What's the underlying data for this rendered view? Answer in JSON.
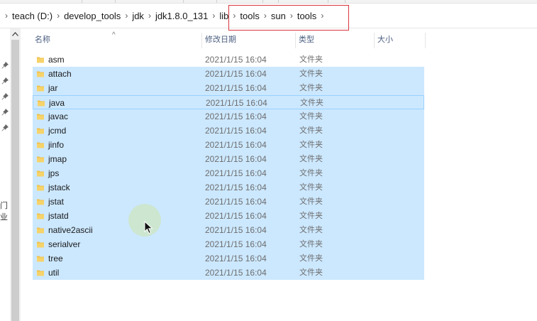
{
  "breadcrumb": {
    "items": [
      "teach (D:)",
      "develop_tools",
      "jdk",
      "jdk1.8.0_131",
      "lib",
      "tools",
      "sun",
      "tools"
    ]
  },
  "nav": {
    "stub_text": "门业"
  },
  "columns": {
    "name": "名称",
    "date": "修改日期",
    "type": "类型",
    "size": "大小"
  },
  "files": [
    {
      "name": "asm",
      "date": "2021/1/15 16:04",
      "type": "文件夹",
      "size": "",
      "selected": false
    },
    {
      "name": "attach",
      "date": "2021/1/15 16:04",
      "type": "文件夹",
      "size": "",
      "selected": true
    },
    {
      "name": "jar",
      "date": "2021/1/15 16:04",
      "type": "文件夹",
      "size": "",
      "selected": true
    },
    {
      "name": "java",
      "date": "2021/1/15 16:04",
      "type": "文件夹",
      "size": "",
      "selected": true,
      "focused": true
    },
    {
      "name": "javac",
      "date": "2021/1/15 16:04",
      "type": "文件夹",
      "size": "",
      "selected": true
    },
    {
      "name": "jcmd",
      "date": "2021/1/15 16:04",
      "type": "文件夹",
      "size": "",
      "selected": true
    },
    {
      "name": "jinfo",
      "date": "2021/1/15 16:04",
      "type": "文件夹",
      "size": "",
      "selected": true
    },
    {
      "name": "jmap",
      "date": "2021/1/15 16:04",
      "type": "文件夹",
      "size": "",
      "selected": true
    },
    {
      "name": "jps",
      "date": "2021/1/15 16:04",
      "type": "文件夹",
      "size": "",
      "selected": true
    },
    {
      "name": "jstack",
      "date": "2021/1/15 16:04",
      "type": "文件夹",
      "size": "",
      "selected": true
    },
    {
      "name": "jstat",
      "date": "2021/1/15 16:04",
      "type": "文件夹",
      "size": "",
      "selected": true
    },
    {
      "name": "jstatd",
      "date": "2021/1/15 16:04",
      "type": "文件夹",
      "size": "",
      "selected": true
    },
    {
      "name": "native2ascii",
      "date": "2021/1/15 16:04",
      "type": "文件夹",
      "size": "",
      "selected": true
    },
    {
      "name": "serialver",
      "date": "2021/1/15 16:04",
      "type": "文件夹",
      "size": "",
      "selected": true
    },
    {
      "name": "tree",
      "date": "2021/1/15 16:04",
      "type": "文件夹",
      "size": "",
      "selected": true
    },
    {
      "name": "util",
      "date": "2021/1/15 16:04",
      "type": "文件夹",
      "size": "",
      "selected": true
    }
  ],
  "colors": {
    "selection": "#cce8ff",
    "focus_border": "#99d1ff",
    "folder": "#f0c14b",
    "highlight_box": "#d9363e"
  },
  "icons": {
    "folder": "folder-icon",
    "pin": "pin-icon",
    "chevron": "chevron-right-icon",
    "sort": "sort-up-icon",
    "cursor": "mouse-cursor-icon"
  }
}
